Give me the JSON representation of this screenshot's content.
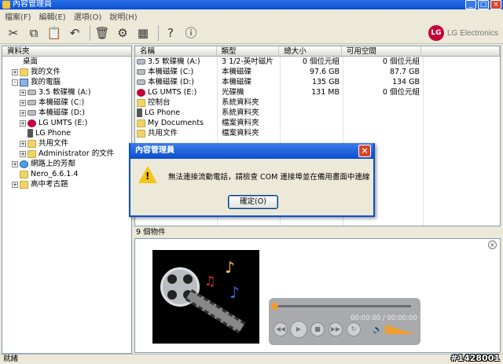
{
  "window": {
    "title": "內容管理員",
    "buttons": [
      "_",
      "□",
      "×"
    ]
  },
  "menu": [
    "檔案(F)",
    "編輯(E)",
    "選項(O)",
    "說明(H)"
  ],
  "toolbar": {
    "buttons": [
      "scissors-icon",
      "copy-icon",
      "paste-icon",
      "undo-icon",
      "delete-icon",
      "properties-icon",
      "view-icon",
      "help-icon",
      "info-icon"
    ],
    "brand": "LG Electronics",
    "brand_logo": "LG"
  },
  "folders": {
    "header": "資料夾",
    "tree": [
      {
        "label": "桌面",
        "indent": 0,
        "expander": "",
        "icon": "desktop"
      },
      {
        "label": "我的文件",
        "indent": 1,
        "expander": "+",
        "icon": "folder"
      },
      {
        "label": "我的電腦",
        "indent": 1,
        "expander": "-",
        "icon": "computer"
      },
      {
        "label": "3.5 軟碟機 (A:)",
        "indent": 2,
        "expander": "+",
        "icon": "drive"
      },
      {
        "label": "本機磁碟 (C:)",
        "indent": 2,
        "expander": "+",
        "icon": "drive"
      },
      {
        "label": "本機磁碟 (D:)",
        "indent": 2,
        "expander": "+",
        "icon": "drive"
      },
      {
        "label": "LG UMTS (E:)",
        "indent": 2,
        "expander": "+",
        "icon": "lg"
      },
      {
        "label": "LG Phone",
        "indent": 2,
        "expander": "",
        "icon": "phone"
      },
      {
        "label": "共用文件",
        "indent": 2,
        "expander": "+",
        "icon": "folder"
      },
      {
        "label": "Administrator 的文件",
        "indent": 2,
        "expander": "+",
        "icon": "folder"
      },
      {
        "label": "網路上的芳鄰",
        "indent": 1,
        "expander": "+",
        "icon": "globe"
      },
      {
        "label": "Nero_6.6.1.4",
        "indent": 1,
        "expander": "",
        "icon": "folder"
      },
      {
        "label": "高中考古題",
        "indent": 1,
        "expander": "+",
        "icon": "folder"
      }
    ]
  },
  "files": {
    "columns": [
      "名稱",
      "類型",
      "總大小",
      "可用空間"
    ],
    "rows": [
      {
        "name": "3.5 軟碟機 (A:)",
        "type": "3 1/2-英吋磁片",
        "total": "0 個位元組",
        "free": "0 個位元組",
        "icon": "drive"
      },
      {
        "name": "本機磁碟 (C:)",
        "type": "本機磁碟",
        "total": "97.6 GB",
        "free": "87.7 GB",
        "icon": "drive"
      },
      {
        "name": "本機磁碟 (D:)",
        "type": "本機磁碟",
        "total": "135 GB",
        "free": "134 GB",
        "icon": "drive"
      },
      {
        "name": "LG UMTS (E:)",
        "type": "光碟機",
        "total": "131 MB",
        "free": "0 個位元組",
        "icon": "lg"
      },
      {
        "name": "控制台",
        "type": "系統資料夾",
        "total": "",
        "free": "",
        "icon": "folder"
      },
      {
        "name": "LG Phone",
        "type": "系統資料夾",
        "total": "",
        "free": "",
        "icon": "phone"
      },
      {
        "name": "My Documents",
        "type": "檔案資料夾",
        "total": "",
        "free": "",
        "icon": "folder"
      },
      {
        "name": "共用文件",
        "type": "檔案資料夾",
        "total": "",
        "free": "",
        "icon": "folder"
      }
    ]
  },
  "count_label": "9 個物件",
  "player": {
    "time": "00:00:00 / 00:00:00",
    "progress": 0
  },
  "status": "就緒",
  "watermark": "#1428001",
  "dialog": {
    "title": "內容管理員",
    "message": "無法連接流動電話，請檢查 COM 連接埠並在備用畫面中連線",
    "ok_label": "確定(O)"
  }
}
